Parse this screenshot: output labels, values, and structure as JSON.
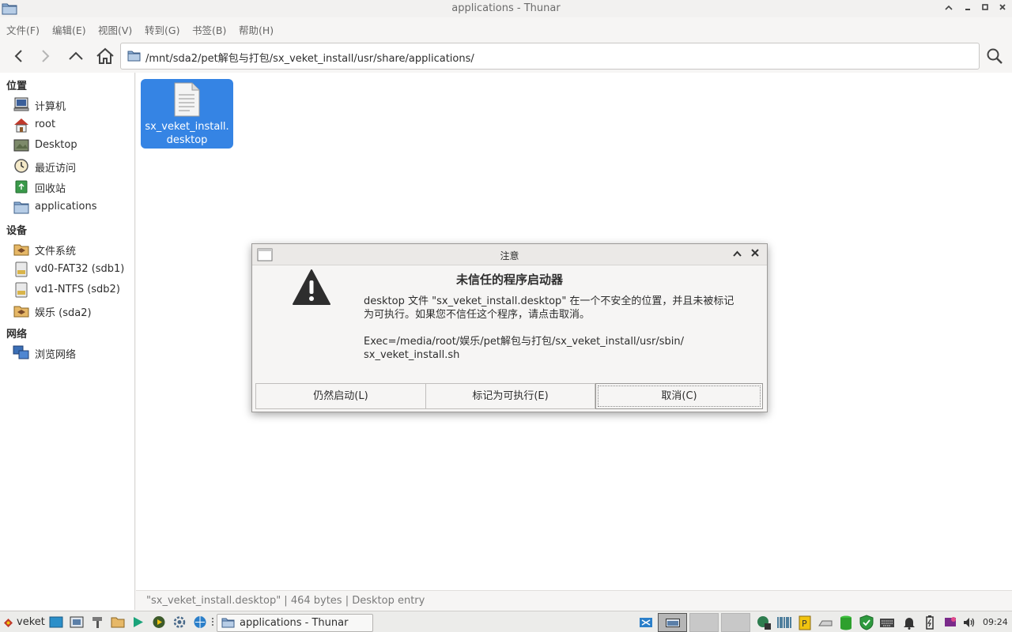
{
  "window": {
    "title": "applications - Thunar"
  },
  "menu": [
    "文件(F)",
    "编辑(E)",
    "视图(V)",
    "转到(G)",
    "书签(B)",
    "帮助(H)"
  ],
  "location": {
    "path": "/mnt/sda2/pet解包与打包/sx_veket_install/usr/share/applications/"
  },
  "sidebar": {
    "places_header": "位置",
    "places": [
      "计算机",
      "root",
      "Desktop",
      "最近访问",
      "回收站",
      "applications"
    ],
    "devices_header": "设备",
    "devices": [
      "文件系统",
      "vd0-FAT32 (sdb1)",
      "vd1-NTFS (sdb2)",
      "娱乐 (sda2)"
    ],
    "network_header": "网络",
    "network": [
      "浏览网络"
    ]
  },
  "files": [
    {
      "name_line1": "sx_veket_install.",
      "name_line2": "desktop",
      "icon": "text-document-icon"
    }
  ],
  "status": {
    "text": "\"sx_veket_install.desktop\"  |  464 bytes  |  Desktop entry"
  },
  "dialog": {
    "title": "注意",
    "heading": "未信任的程序启动器",
    "message_line1": "desktop 文件 \"sx_veket_install.desktop\" 在一个不安全的位置，并且未被标记",
    "message_line2": "为可执行。如果您不信任这个程序，请点击取消。",
    "exec_line1": "Exec=/media/root/娱乐/pet解包与打包/sx_veket_install/usr/sbin/",
    "exec_line2": "sx_veket_install.sh",
    "buttons": {
      "launch_anyway": "仍然启动(L)",
      "mark_executable": "标记为可执行(E)",
      "cancel": "取消(C)"
    }
  },
  "taskbar": {
    "start_label": "veket",
    "task_label": "applications - Thunar",
    "clock": "09:24"
  },
  "colors": {
    "selection": "#3584e4",
    "folder": "#7f9cc1",
    "warning": "#2e2e2e"
  }
}
